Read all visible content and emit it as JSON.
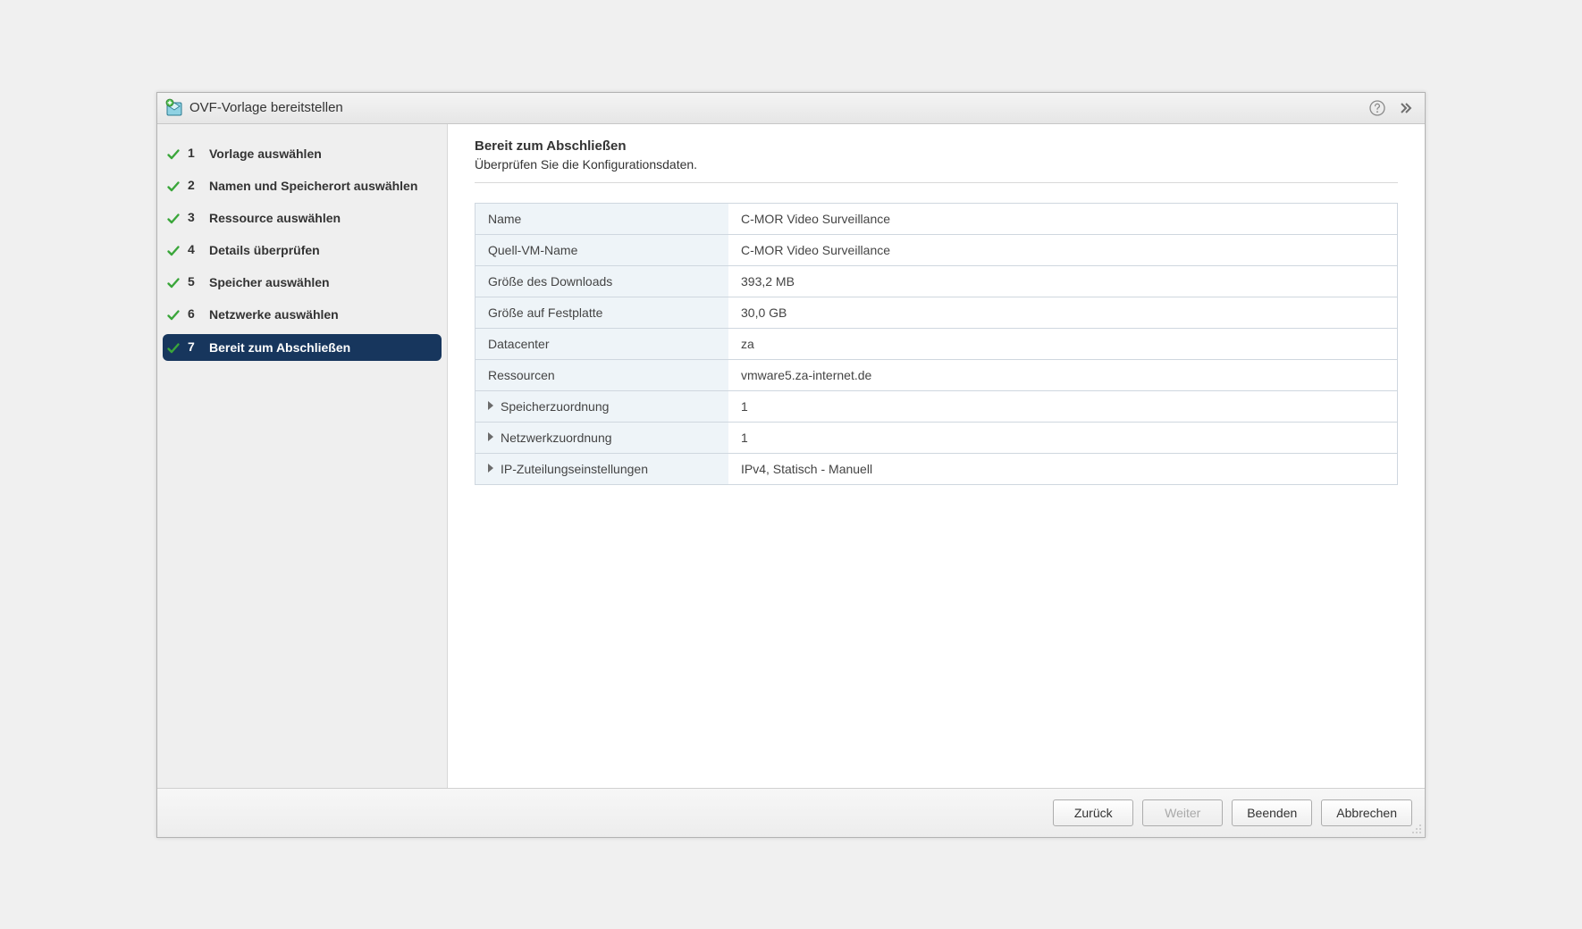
{
  "titlebar": {
    "title": "OVF-Vorlage bereitstellen"
  },
  "sidebar": {
    "steps": [
      {
        "num": "1",
        "label": "Vorlage auswählen",
        "done": true,
        "active": false
      },
      {
        "num": "2",
        "label": "Namen und Speicherort auswählen",
        "done": true,
        "active": false
      },
      {
        "num": "3",
        "label": "Ressource auswählen",
        "done": true,
        "active": false
      },
      {
        "num": "4",
        "label": "Details überprüfen",
        "done": true,
        "active": false
      },
      {
        "num": "5",
        "label": "Speicher auswählen",
        "done": true,
        "active": false
      },
      {
        "num": "6",
        "label": "Netzwerke auswählen",
        "done": true,
        "active": false
      },
      {
        "num": "7",
        "label": "Bereit zum Abschließen",
        "done": true,
        "active": true
      }
    ]
  },
  "main": {
    "heading": "Bereit zum Abschließen",
    "subheading": "Überprüfen Sie die Konfigurationsdaten.",
    "rows": [
      {
        "key": "Name",
        "value": "C-MOR Video Surveillance",
        "expandable": false
      },
      {
        "key": "Quell-VM-Name",
        "value": "C-MOR Video Surveillance",
        "expandable": false
      },
      {
        "key": "Größe des Downloads",
        "value": "393,2 MB",
        "expandable": false
      },
      {
        "key": "Größe auf Festplatte",
        "value": "30,0 GB",
        "expandable": false
      },
      {
        "key": "Datacenter",
        "value": "za",
        "expandable": false
      },
      {
        "key": "Ressourcen",
        "value": "vmware5.za-internet.de",
        "expandable": false
      },
      {
        "key": "Speicherzuordnung",
        "value": "1",
        "expandable": true
      },
      {
        "key": "Netzwerkzuordnung",
        "value": "1",
        "expandable": true
      },
      {
        "key": "IP-Zuteilungseinstellungen",
        "value": "IPv4, Statisch - Manuell",
        "expandable": true
      }
    ]
  },
  "footer": {
    "back": "Zurück",
    "next": "Weiter",
    "finish": "Beenden",
    "cancel": "Abbrechen",
    "next_disabled": true
  }
}
